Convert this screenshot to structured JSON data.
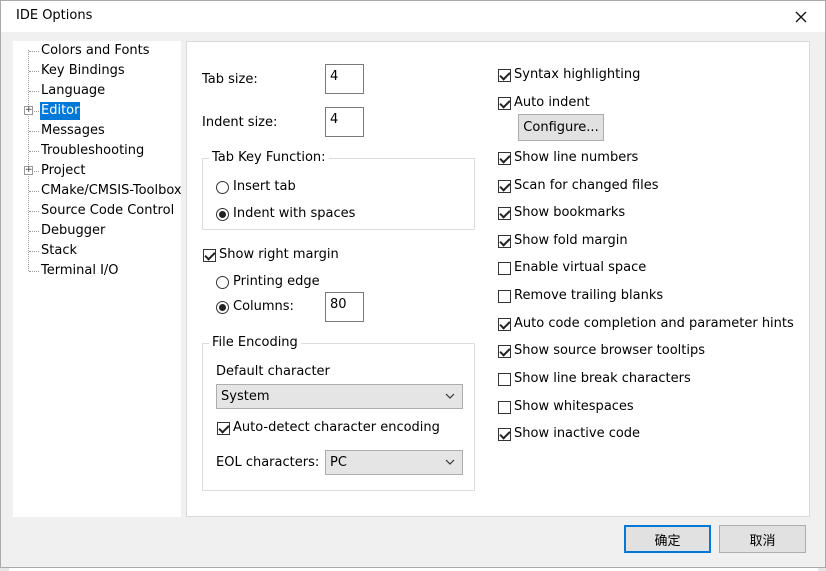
{
  "window": {
    "title": "IDE Options"
  },
  "tree": {
    "items": [
      {
        "label": "Colors and Fonts",
        "expandable": false,
        "selected": false
      },
      {
        "label": "Key Bindings",
        "expandable": false,
        "selected": false
      },
      {
        "label": "Language",
        "expandable": false,
        "selected": false
      },
      {
        "label": "Editor",
        "expandable": true,
        "selected": true
      },
      {
        "label": "Messages",
        "expandable": false,
        "selected": false
      },
      {
        "label": "Troubleshooting",
        "expandable": false,
        "selected": false
      },
      {
        "label": "Project",
        "expandable": true,
        "selected": false
      },
      {
        "label": "CMake/CMSIS-Toolbox",
        "expandable": false,
        "selected": false
      },
      {
        "label": "Source Code Control",
        "expandable": false,
        "selected": false
      },
      {
        "label": "Debugger",
        "expandable": false,
        "selected": false
      },
      {
        "label": "Stack",
        "expandable": false,
        "selected": false
      },
      {
        "label": "Terminal I/O",
        "expandable": false,
        "selected": false
      }
    ]
  },
  "editor": {
    "tab_size_label": "Tab size:",
    "tab_size_value": "4",
    "indent_size_label": "Indent size:",
    "indent_size_value": "4",
    "tab_key_group": "Tab Key Function:",
    "insert_tab_label": "Insert tab",
    "indent_spaces_label": "Indent with spaces",
    "show_right_margin_label": "Show right margin",
    "printing_edge_label": "Printing edge",
    "columns_label": "Columns:",
    "columns_value": "80",
    "file_encoding_group": "File Encoding",
    "default_char_label": "Default character",
    "default_char_value": "System",
    "auto_detect_label": "Auto-detect character encoding",
    "eol_label": "EOL characters:",
    "eol_value": "PC",
    "configure_label": "Configure..."
  },
  "options": [
    {
      "label": "Syntax highlighting",
      "checked": true
    },
    {
      "label": "Auto indent",
      "checked": true
    },
    {
      "label": "Show line numbers",
      "checked": true
    },
    {
      "label": "Scan for changed files",
      "checked": true
    },
    {
      "label": "Show bookmarks",
      "checked": true
    },
    {
      "label": "Show fold margin",
      "checked": true
    },
    {
      "label": "Enable virtual space",
      "checked": false
    },
    {
      "label": "Remove trailing blanks",
      "checked": false
    },
    {
      "label": "Auto code completion and parameter hints",
      "checked": true
    },
    {
      "label": "Show source browser tooltips",
      "checked": true
    },
    {
      "label": "Show line break characters",
      "checked": false
    },
    {
      "label": "Show whitespaces",
      "checked": false
    },
    {
      "label": "Show inactive code",
      "checked": true
    }
  ],
  "buttons": {
    "ok_label": "确定",
    "cancel_label": "取消"
  }
}
